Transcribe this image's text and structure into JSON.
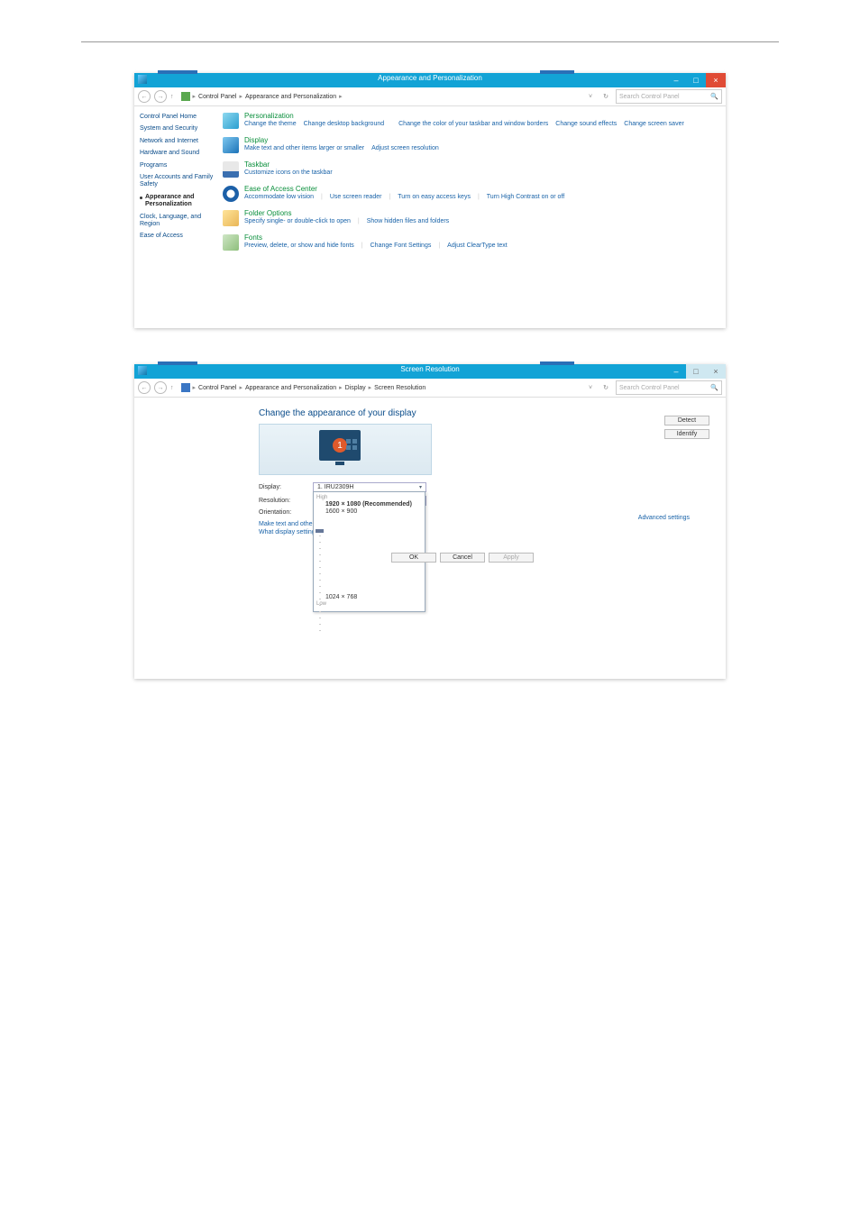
{
  "shot1": {
    "title": "Appearance and Personalization",
    "breadcrumb": [
      "Control Panel",
      "Appearance and Personalization"
    ],
    "search_placeholder": "Search Control Panel",
    "sidebar": [
      "Control Panel Home",
      "System and Security",
      "Network and Internet",
      "Hardware and Sound",
      "Programs",
      "User Accounts and Family Safety",
      "Appearance and Personalization",
      "Clock, Language, and Region",
      "Ease of Access"
    ],
    "cats": [
      {
        "title": "Personalization",
        "links": [
          "Change the theme",
          "Change desktop background",
          "Change the color of your taskbar and window borders",
          "Change sound effects",
          "Change screen saver"
        ]
      },
      {
        "title": "Display",
        "links": [
          "Make text and other items larger or smaller",
          "Adjust screen resolution"
        ]
      },
      {
        "title": "Taskbar",
        "links": [
          "Customize icons on the taskbar"
        ]
      },
      {
        "title": "Ease of Access Center",
        "links": [
          "Accommodate low vision",
          "Use screen reader",
          "Turn on easy access keys",
          "Turn High Contrast on or off"
        ]
      },
      {
        "title": "Folder Options",
        "links": [
          "Specify single- or double-click to open",
          "Show hidden files and folders"
        ]
      },
      {
        "title": "Fonts",
        "links": [
          "Preview, delete, or show and hide fonts",
          "Change Font Settings",
          "Adjust ClearType text"
        ]
      }
    ]
  },
  "shot2": {
    "title": "Screen Resolution",
    "breadcrumb": [
      "Control Panel",
      "Appearance and Personalization",
      "Display",
      "Screen Resolution"
    ],
    "search_placeholder": "Search Control Panel",
    "heading": "Change the appearance of your display",
    "detect": "Detect",
    "identify": "Identify",
    "display_label": "Display:",
    "display_value": "1. IRU2309H",
    "res_label": "Resolution:",
    "res_value": "1920 × 1080 (Recommended)",
    "orient_label": "Orientation:",
    "dd_high": "High",
    "dd_opts": [
      "1920 × 1080 (Recommended)",
      "1600 × 900"
    ],
    "dd_low_opt": "1024 × 768",
    "dd_low": "Low",
    "link1": "Make text and other",
    "link2": "What display setting",
    "advanced": "Advanced settings",
    "ok": "OK",
    "cancel": "Cancel",
    "apply": "Apply"
  }
}
